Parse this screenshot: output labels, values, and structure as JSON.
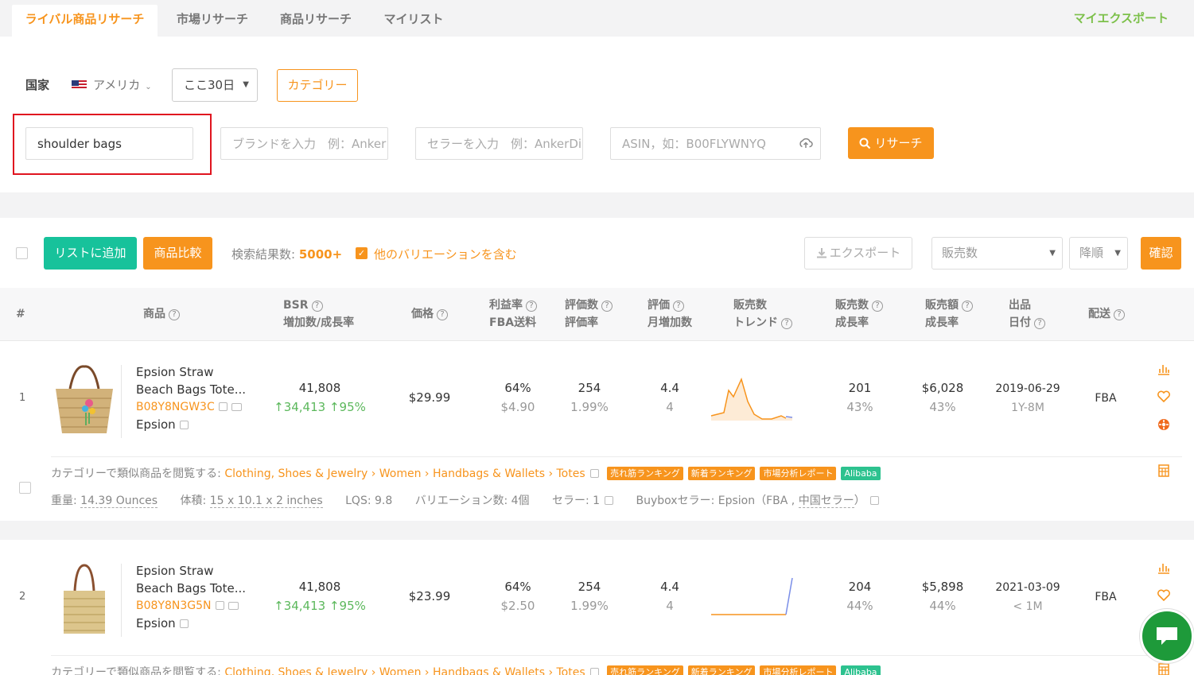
{
  "tabs": [
    {
      "label": "ライバル商品リサーチ",
      "active": true
    },
    {
      "label": "市場リサーチ"
    },
    {
      "label": "商品リサーチ"
    },
    {
      "label": "マイリスト"
    }
  ],
  "my_export": "マイエクスポート",
  "filters": {
    "country_label": "国家",
    "country_value": "アメリカ",
    "period_value": "ここ30日",
    "category_button": "カテゴリー",
    "keyword_value": "shoulder bags",
    "brand_placeholder": "ブランドを入力　例：Anker",
    "seller_placeholder": "セラーを入力　例：AnkerDirect",
    "asin_placeholder": "ASIN，如：B00FLYWNYQ",
    "search_button": "リサーチ"
  },
  "actions": {
    "add_to_list": "リストに追加",
    "compare": "商品比較",
    "result_label": "検索結果数:",
    "result_count": "5000+",
    "include_variations": "他のバリエーションを含む",
    "export": "エクスポート",
    "sort_field": "販売数",
    "sort_order": "降順",
    "confirm": "確認"
  },
  "columns": {
    "num": "#",
    "product": "商品",
    "bsr": "BSR",
    "bsr_sub": "増加数/成長率",
    "price": "価格",
    "margin": "利益率",
    "margin_sub": "FBA送料",
    "reviews": "評価数",
    "reviews_sub": "評価率",
    "rating": "評価",
    "rating_sub": "月増加数",
    "sales_trend": "販売数",
    "sales_trend_sub": "トレンド",
    "sales": "販売数",
    "sales_sub": "成長率",
    "revenue": "販売額",
    "revenue_sub": "成長率",
    "listed": "出品",
    "listed_sub": "日付",
    "shipping": "配送"
  },
  "rows": [
    {
      "num": "1",
      "title_line1": "Epsion Straw",
      "title_line2": "Beach Bags Tote...",
      "asin": "B08Y8NGW3C",
      "brand": "Epsion",
      "bsr": "41,808",
      "bsr_inc": "34,413",
      "bsr_rate": "95%",
      "price": "$29.99",
      "margin": "64%",
      "fba_fee": "$4.90",
      "reviews": "254",
      "review_rate": "1.99%",
      "rating": "4.4",
      "rating_monthly": "4",
      "sales": "201",
      "sales_growth": "43%",
      "revenue": "$6,028",
      "revenue_growth": "43%",
      "date": "2019-06-29",
      "age": "1Y-8M",
      "shipping": "FBA",
      "category_prefix": "カテゴリーで類似商品を閲覧する:",
      "category_path": "Clothing, Shoes & Jewelry › Women › Handbags & Wallets › Totes",
      "tags": [
        "売れ筋ランキング",
        "新着ランキング",
        "市場分析レポート",
        "Alibaba"
      ],
      "weight_label": "重量:",
      "weight": "14.39 Ounces",
      "size_label": "体積:",
      "size": "15 x 10.1 x 2 inches",
      "lqs": "LQS: 9.8",
      "variations": "バリエーション数: 4個",
      "sellers": "セラー: 1",
      "buybox_label": "Buyboxセラー:",
      "buybox_seller": "Epsion",
      "buybox_fba": "（FBA ,",
      "buybox_origin": "中国セラー",
      "buybox_close": "）"
    },
    {
      "num": "2",
      "title_line1": "Epsion Straw",
      "title_line2": "Beach Bags Tote...",
      "asin": "B08Y8N3G5N",
      "brand": "Epsion",
      "bsr": "41,808",
      "bsr_inc": "34,413",
      "bsr_rate": "95%",
      "price": "$23.99",
      "margin": "64%",
      "fba_fee": "$2.50",
      "reviews": "254",
      "review_rate": "1.99%",
      "rating": "4.4",
      "rating_monthly": "4",
      "sales": "204",
      "sales_growth": "44%",
      "revenue": "$5,898",
      "revenue_growth": "44%",
      "date": "2021-03-09",
      "age": "< 1M",
      "shipping": "FBA",
      "category_prefix": "カテゴリーで類似商品を閲覧する:",
      "category_path": "Clothing, Shoes & Jewelry › Women › Handbags & Wallets › Totes",
      "tags": [
        "売れ筋ランキング",
        "新着ランキング",
        "市場分析レポート",
        "Alibaba"
      ]
    }
  ],
  "colors": {
    "accent": "#f7941d",
    "teal": "#17c29b",
    "green": "#7cc04a",
    "alibaba": "#2dc28f"
  }
}
